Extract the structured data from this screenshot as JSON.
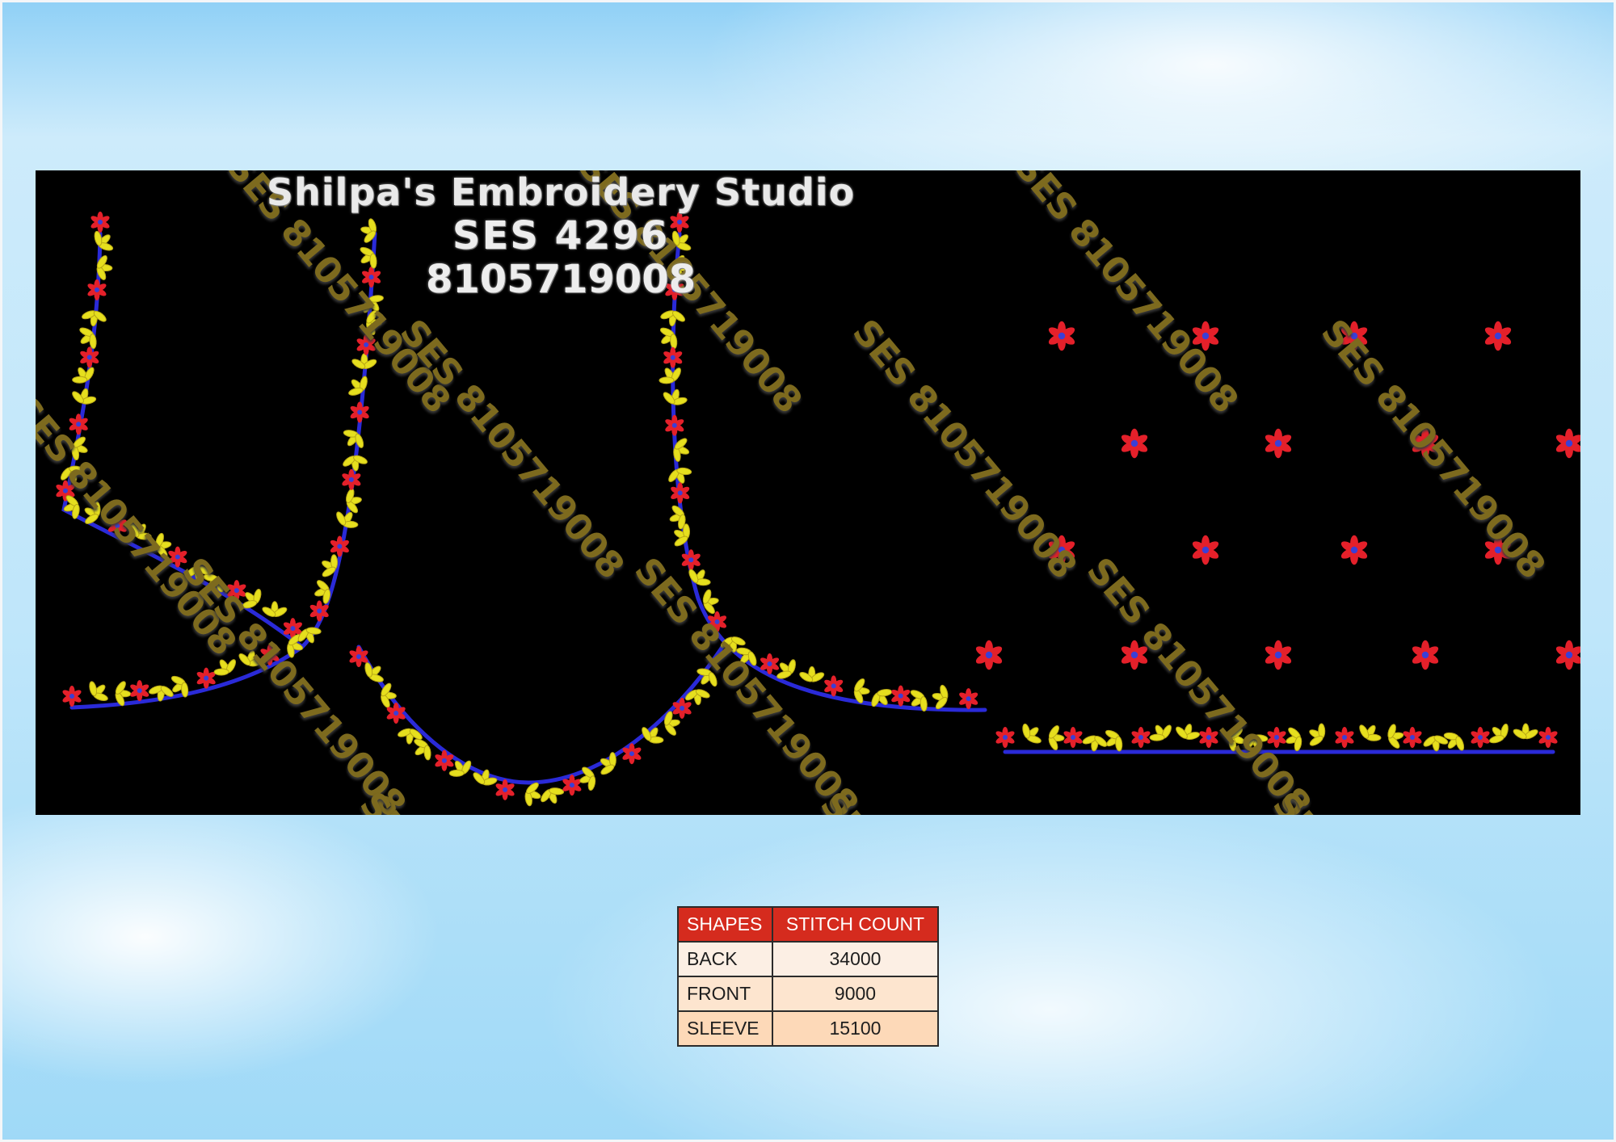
{
  "studio": {
    "name": "Shilpa's Embroidery Studio",
    "code": "SES 4296",
    "phone": "8105719008"
  },
  "watermarks": [
    "SES 8105719008",
    "SES 8105719008",
    "SES 8105719008",
    "SES 8105719008",
    "SES 8105719008",
    "SES 8105719008",
    "SES 8105719008",
    "SES 8105719008",
    "SES 8105719008",
    "SES 8105719008",
    "SES 8105719008",
    "SES 8105719008",
    "SES 8105719008"
  ],
  "stitch_table": {
    "headers": [
      "SHAPES",
      "STITCH COUNT"
    ],
    "rows": [
      {
        "shape": "BACK",
        "count": "34000",
        "bg": "#fcefe4"
      },
      {
        "shape": "FRONT",
        "count": "9000",
        "bg": "#fde5cf"
      },
      {
        "shape": "SLEEVE",
        "count": "15100",
        "bg": "#fdd9b8"
      }
    ]
  },
  "colors": {
    "background": "#000000",
    "outline": "#2a2ad8",
    "leaf": "#e6df1e",
    "flower": "#e4202a",
    "flower_center": "#3b3fd6",
    "header": "#d52b1e",
    "watermark": "#7d6a1e"
  }
}
